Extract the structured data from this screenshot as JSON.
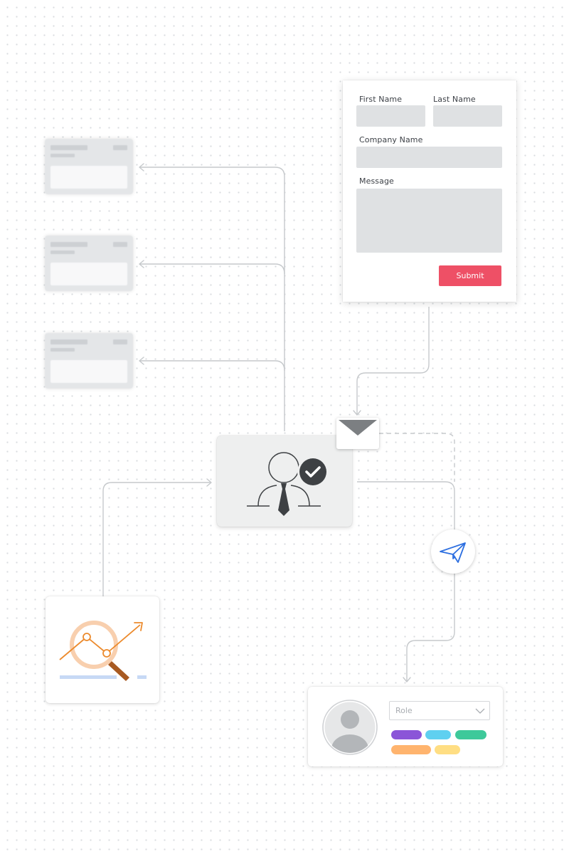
{
  "contact_form": {
    "first_name_label": "First Name",
    "last_name_label": "Last Name",
    "company_name_label": "Company Name",
    "message_label": "Message",
    "submit_label": "Submit",
    "submit_color": "#ee5066"
  },
  "placeholder_cards": [
    {
      "state": "greyed-out"
    },
    {
      "state": "greyed-out"
    },
    {
      "state": "greyed-out"
    }
  ],
  "hub": {
    "icon": "person-check-icon",
    "attached_icon": "envelope-icon"
  },
  "send": {
    "icon": "paper-plane-icon",
    "accent": "#2d6fe0"
  },
  "analytics": {
    "icon": "magnifier-trend-icon",
    "accent": "#ec8a2c",
    "handle": "#a85a22",
    "baseline": "#c7d9f5"
  },
  "profile_card": {
    "role_placeholder": "Role",
    "icon": "avatar-icon",
    "tag_colors": [
      "#8b55d8",
      "#5fd0f0",
      "#3ec99a",
      "#ffb46e",
      "#ffde83"
    ]
  }
}
